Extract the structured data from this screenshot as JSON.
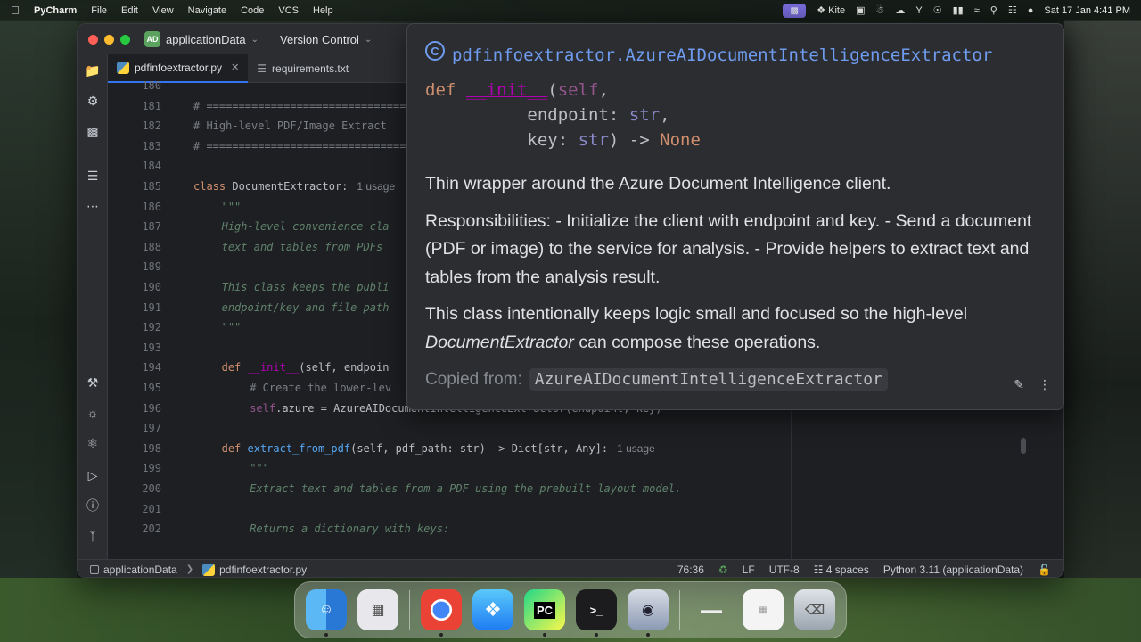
{
  "menubar": {
    "app": "PyCharm",
    "items": [
      "File",
      "Edit",
      "View",
      "Navigate",
      "Code",
      "VCS",
      "Help"
    ],
    "kite": "Kite",
    "datetime": "Sat 17 Jan  4:41 PM"
  },
  "window": {
    "project_badge": "AD",
    "project_name": "applicationData",
    "vcs_label": "Version Control"
  },
  "tabs": [
    {
      "label": "pdfinfoextractor.py",
      "active": true
    },
    {
      "label": "requirements.txt",
      "active": false
    }
  ],
  "code": {
    "lines": [
      {
        "n": "180",
        "html": ""
      },
      {
        "n": "181",
        "cls": "c-cmt",
        "indent": 0,
        "text": "# ==============================="
      },
      {
        "n": "182",
        "cls": "c-cmt",
        "indent": 0,
        "text": "# High-level PDF/Image Extract"
      },
      {
        "n": "183",
        "cls": "c-cmt",
        "indent": 0,
        "text": "# ==============================="
      },
      {
        "n": "184",
        "cls": "c-plain",
        "indent": 0,
        "text": ""
      },
      {
        "n": "185",
        "cls": "class",
        "indent": 0,
        "kw": "class ",
        "name": "DocumentExtractor",
        "rest": ":",
        "usage": "1 usage"
      },
      {
        "n": "186",
        "cls": "c-doc",
        "indent": 4,
        "text": "\"\"\""
      },
      {
        "n": "187",
        "cls": "c-doc",
        "indent": 4,
        "text": "High-level convenience cla"
      },
      {
        "n": "188",
        "cls": "c-doc",
        "indent": 4,
        "text": "text and tables from PDFs"
      },
      {
        "n": "189",
        "cls": "c-doc",
        "indent": 4,
        "text": ""
      },
      {
        "n": "190",
        "cls": "c-doc",
        "indent": 4,
        "text": "This class keeps the publi"
      },
      {
        "n": "191",
        "cls": "c-doc",
        "indent": 4,
        "text": "endpoint/key and file path"
      },
      {
        "n": "192",
        "cls": "c-doc",
        "indent": 4,
        "text": "\"\"\""
      },
      {
        "n": "193",
        "cls": "c-plain",
        "indent": 0,
        "text": ""
      },
      {
        "n": "194",
        "cls": "init",
        "indent": 4,
        "text": "__init__(self, endpoin"
      },
      {
        "n": "195",
        "cls": "c-cmt",
        "indent": 8,
        "text": "# Create the lower-lev"
      },
      {
        "n": "196",
        "cls": "assign",
        "indent": 8,
        "text": ".azure = AzureAIDocumentIntelligenceExtractor(endpoint, key)"
      },
      {
        "n": "197",
        "cls": "c-plain",
        "indent": 0,
        "text": ""
      },
      {
        "n": "198",
        "cls": "def",
        "indent": 4,
        "name": "extract_from_pdf",
        "rest": "(self, pdf_path: str) -> Dict[str, Any]:",
        "usage": "1 usage"
      },
      {
        "n": "199",
        "cls": "c-doc",
        "indent": 8,
        "text": "\"\"\""
      },
      {
        "n": "200",
        "cls": "c-doc",
        "indent": 8,
        "text": "Extract text and tables from a PDF using the prebuilt layout model."
      },
      {
        "n": "201",
        "cls": "c-doc",
        "indent": 8,
        "text": ""
      },
      {
        "n": "202",
        "cls": "c-doc",
        "indent": 8,
        "text": "Returns a dictionary with keys:"
      }
    ]
  },
  "popup": {
    "path": "pdfinfoextractor.AzureAIDocumentIntelligenceExtractor",
    "doc_p1": "Thin wrapper around the Azure Document Intelligence client.",
    "doc_p2": "Responsibilities: - Initialize the client with endpoint and key. - Send a document (PDF or image) to the service for analysis. - Provide helpers to extract text and tables from the analysis result.",
    "doc_p3_a": "This class intentionally keeps logic small and focused so the high-level",
    "doc_p3_em": "DocumentExtractor",
    "doc_p3_b": "can compose these operations.",
    "copied_label": "Copied from:",
    "copied_value": "AzureAIDocumentIntelligenceExtractor"
  },
  "statusbar": {
    "project": "applicationData",
    "file": "pdfinfoextractor.py",
    "position": "76:36",
    "line_sep": "LF",
    "encoding": "UTF-8",
    "indent": "4 spaces",
    "interpreter": "Python 3.11 (applicationData)"
  },
  "dock": {
    "apps": [
      "Finder",
      "Launchpad",
      "Chrome",
      "Safari",
      "PyCharm",
      "Terminal",
      "Disk Utility"
    ]
  }
}
